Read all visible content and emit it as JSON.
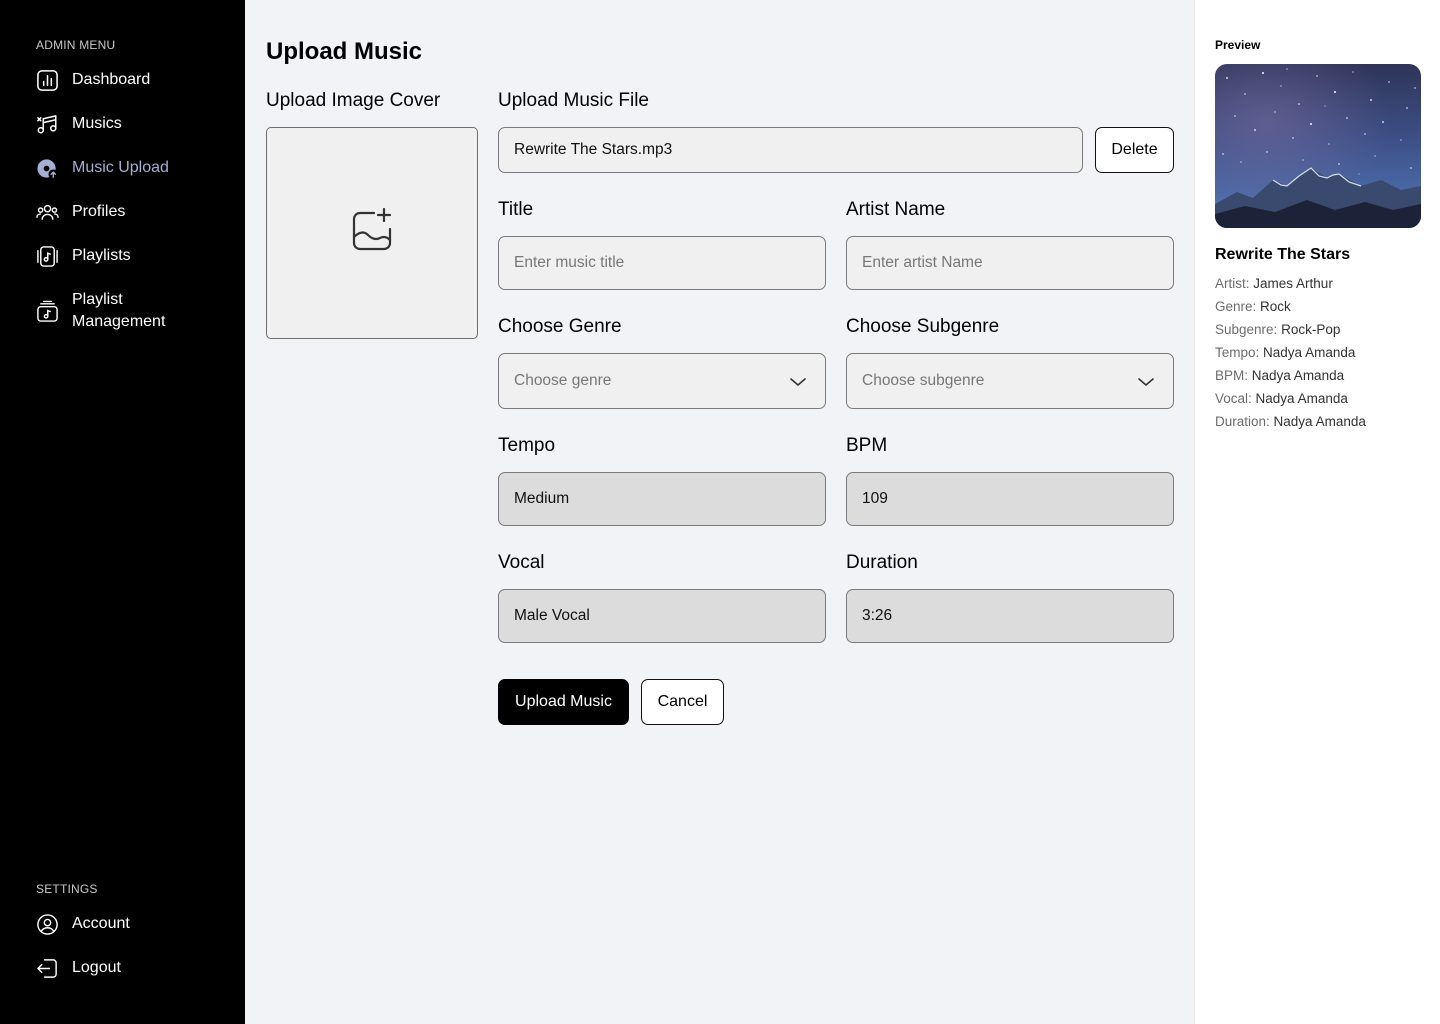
{
  "sidebar": {
    "admin_menu_label": "ADMIN MENU",
    "items": [
      {
        "label": "Dashboard",
        "icon": "chart-bars-icon"
      },
      {
        "label": "Musics",
        "icon": "music-notes-icon"
      },
      {
        "label": "Music Upload",
        "icon": "music-upload-icon",
        "active": true
      },
      {
        "label": "Profiles",
        "icon": "users-icon"
      },
      {
        "label": "Playlists",
        "icon": "playlist-icon"
      },
      {
        "label": "Playlist Management",
        "icon": "playlist-management-icon"
      }
    ],
    "settings_label": "SETTINGS",
    "settings_items": [
      {
        "label": "Account",
        "icon": "user-circle-icon"
      },
      {
        "label": "Logout",
        "icon": "logout-icon"
      }
    ],
    "active_color": "#a4afd3"
  },
  "main": {
    "title": "Upload Music",
    "cover_label": "Upload Image Cover",
    "file_label": "Upload Music File",
    "file_value": "Rewrite The Stars.mp3",
    "delete_label": "Delete",
    "title_label": "Title",
    "title_placeholder": "Enter music title",
    "artist_label": "Artist Name",
    "artist_placeholder": "Enter artist Name",
    "genre_label": "Choose Genre",
    "genre_placeholder": "Choose genre",
    "subgenre_label": "Choose Subgenre",
    "subgenre_placeholder": "Choose subgenre",
    "tempo_label": "Tempo",
    "tempo_value": "Medium",
    "bpm_label": "BPM",
    "bpm_value": "109",
    "vocal_label": "Vocal",
    "vocal_value": "Male Vocal",
    "duration_label": "Duration",
    "duration_value": "3:26",
    "upload_button": "Upload Music",
    "cancel_button": "Cancel"
  },
  "preview": {
    "label": "Preview",
    "title": "Rewrite The Stars",
    "meta": [
      {
        "key": "Artist:",
        "value": "James Arthur"
      },
      {
        "key": "Genre:",
        "value": "Rock"
      },
      {
        "key": "Subgenre:",
        "value": "Rock-Pop"
      },
      {
        "key": "Tempo:",
        "value": "Nadya Amanda"
      },
      {
        "key": "BPM:",
        "value": "Nadya Amanda"
      },
      {
        "key": "Vocal:",
        "value": "Nadya Amanda"
      },
      {
        "key": "Duration:",
        "value": "Nadya Amanda"
      }
    ]
  }
}
